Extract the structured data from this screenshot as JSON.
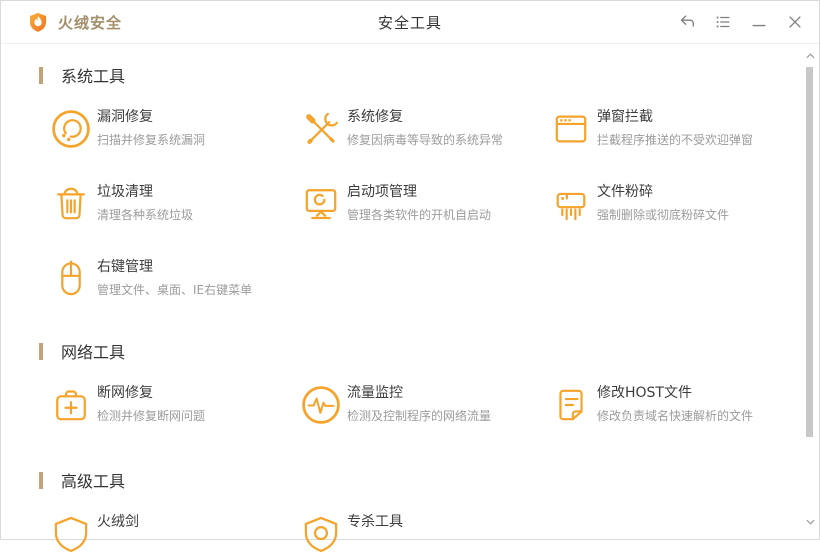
{
  "window": {
    "app_name": "火绒安全",
    "title": "安全工具",
    "controls": [
      {
        "icon": "back-icon"
      },
      {
        "icon": "menu-list-icon"
      },
      {
        "icon": "minimize-icon"
      },
      {
        "icon": "close-icon"
      }
    ]
  },
  "sections": [
    {
      "title": "系统工具",
      "items": [
        {
          "title": "漏洞修复",
          "subtitle": "扫描并修复系统漏洞",
          "icon": "vulnerability-fix-icon"
        },
        {
          "title": "系统修复",
          "subtitle": "修复因病毒等导致的系统异常",
          "icon": "system-repair-icon"
        },
        {
          "title": "弹窗拦截",
          "subtitle": "拦截程序推送的不受欢迎弹窗",
          "icon": "popup-block-icon"
        },
        {
          "title": "垃圾清理",
          "subtitle": "清理各种系统垃圾",
          "icon": "junk-clean-icon"
        },
        {
          "title": "启动项管理",
          "subtitle": "管理各类软件的开机自启动",
          "icon": "startup-manager-icon"
        },
        {
          "title": "文件粉碎",
          "subtitle": "强制删除或彻底粉碎文件",
          "icon": "file-shredder-icon"
        },
        {
          "title": "右键管理",
          "subtitle": "管理文件、桌面、IE右键菜单",
          "icon": "context-menu-icon"
        }
      ]
    },
    {
      "title": "网络工具",
      "items": [
        {
          "title": "断网修复",
          "subtitle": "检测并修复断网问题",
          "icon": "network-repair-icon"
        },
        {
          "title": "流量监控",
          "subtitle": "检测及控制程序的网络流量",
          "icon": "traffic-monitor-icon"
        },
        {
          "title": "修改HOST文件",
          "subtitle": "修改负责域名快速解析的文件",
          "icon": "host-file-icon"
        }
      ]
    },
    {
      "title": "高级工具",
      "items": [
        {
          "title": "火绒剑",
          "icon": "huorong-sword-icon"
        },
        {
          "title": "专杀工具",
          "icon": "killer-tool-icon"
        }
      ]
    }
  ],
  "colors": {
    "accent": "#F5A32A",
    "section_bar": "#C4A278",
    "logo_text": "#A3906B",
    "title_text": "#333333",
    "item_title": "#3D3D3D",
    "item_subtitle": "#9C9C9C",
    "window_icon": "#7F7F7F",
    "scrollbar_thumb": "#C8C8C8"
  }
}
